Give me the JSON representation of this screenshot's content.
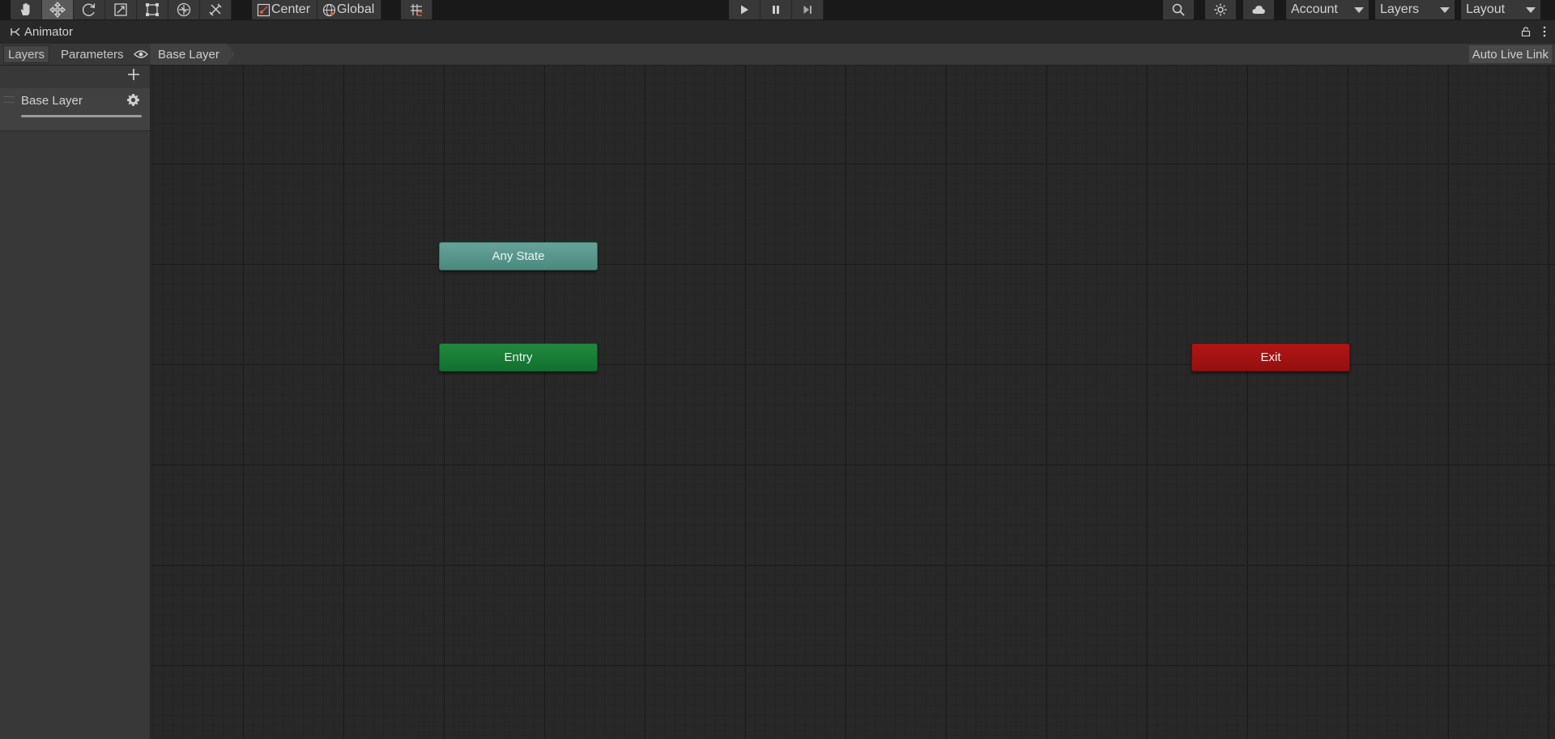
{
  "toolbar": {
    "tools": [
      "hand-tool",
      "move-tool",
      "rotate-tool",
      "scale-tool",
      "rect-tool",
      "transform-tool",
      "custom-tool"
    ],
    "active_tool": "move-tool",
    "pivot_mode": "Center",
    "pivot_rotation": "Global",
    "snap_icon": "grid-snap-icon",
    "playback": [
      "play-icon",
      "pause-icon",
      "step-icon"
    ],
    "right_icons": [
      "search-icon",
      "collab-icon",
      "cloud-icon"
    ],
    "account_label": "Account",
    "layers_label": "Layers",
    "layout_label": "Layout"
  },
  "window": {
    "title": "Animator"
  },
  "animator": {
    "tabs": {
      "layers": "Layers",
      "parameters": "Parameters"
    },
    "breadcrumb": "Base Layer",
    "auto_live_link": "Auto Live Link",
    "layer_list": [
      {
        "name": "Base Layer",
        "weight": 1.0
      }
    ]
  },
  "graph": {
    "nodes": {
      "any_state": "Any State",
      "entry": "Entry",
      "exit": "Exit"
    },
    "colors": {
      "any_state": "#5a988d",
      "entry": "#16803a",
      "exit": "#a31212"
    }
  }
}
